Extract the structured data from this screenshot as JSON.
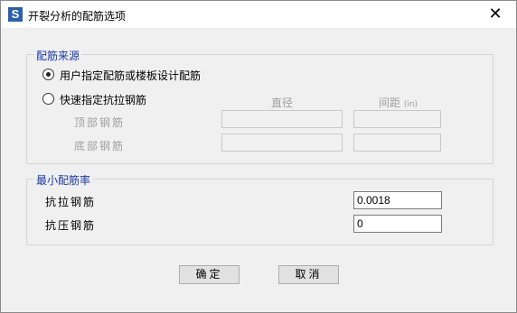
{
  "window": {
    "title": "开裂分析的配筋选项",
    "app_icon_letter": "S",
    "close_glyph": "✕"
  },
  "rebar_source": {
    "legend": "配筋来源",
    "option_user": "用户指定配筋或楼板设计配筋",
    "option_user_checked": true,
    "option_quick": "快速指定抗拉钢筋",
    "option_quick_checked": false,
    "col_diameter": "直径",
    "col_spacing": "间距",
    "col_spacing_unit": "(in)",
    "row_top": "顶部钢筋",
    "row_bottom": "底部钢筋",
    "top_diameter": "",
    "top_spacing": "",
    "bottom_diameter": "",
    "bottom_spacing": ""
  },
  "min_ratio": {
    "legend": "最小配筋率",
    "tension_label": "抗拉钢筋",
    "tension_value": "0.0018",
    "compression_label": "抗压钢筋",
    "compression_value": "0"
  },
  "buttons": {
    "ok": "确定",
    "cancel": "取消"
  }
}
